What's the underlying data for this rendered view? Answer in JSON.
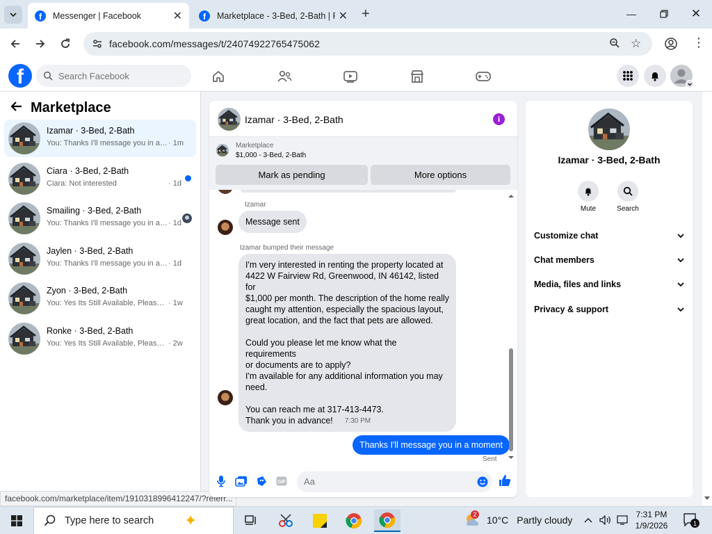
{
  "browser": {
    "tabs": [
      {
        "title": "Messenger | Facebook",
        "active": true
      },
      {
        "title": "Marketplace - 3-Bed, 2-Bath | Fa",
        "active": false
      }
    ],
    "url": "facebook.com/messages/t/24074922765475062",
    "status_url": "facebook.com/marketplace/item/1910318996412247/?referr..."
  },
  "fb_header": {
    "logo": "f",
    "search_placeholder": "Search Facebook"
  },
  "left_panel": {
    "title": "Marketplace",
    "conversations": [
      {
        "title": "Izamar · 3-Bed, 2-Bath",
        "snippet": "You: Thanks I'll message you in a mo...",
        "time": "· 1m",
        "selected": true
      },
      {
        "title": "Ciara · 3-Bed, 2-Bath",
        "snippet": "Ciara: Not interested",
        "time": "· 1d",
        "unread": true
      },
      {
        "title": "Smailing · 3-Bed, 2-Bath",
        "snippet": "You: Thanks I'll message you in a m...",
        "time": "· 1d"
      },
      {
        "title": "Jaylen · 3-Bed, 2-Bath",
        "snippet": "You: Thanks I'll message you in a mo...",
        "time": "· 1d"
      },
      {
        "title": "Zyon · 3-Bed, 2-Bath",
        "snippet": "You: Yes Its Still Available, Please Send...",
        "time": "· 1w"
      },
      {
        "title": "Ronke · 3-Bed, 2-Bath",
        "snippet": "You: Yes Its Still Available, Please Send...",
        "time": "· 2w"
      }
    ]
  },
  "chat": {
    "title": "Izamar · 3-Bed, 2-Bath",
    "marketplace_label": "Marketplace",
    "listing": "$1,000 - 3-Bed, 2-Bath",
    "mark_pending": "Mark as pending",
    "more_options": "More options",
    "sender_name": "Izamar",
    "msg1": "Message sent",
    "bumped_label": "Izamar bumped their message",
    "msg2_lines": [
      "I'm very interested in renting the property located at",
      "4422 W Fairview Rd, Greenwood, IN 46142, listed for",
      "$1,000 per month. The description of the home really",
      "caught my attention, especially the spacious layout,",
      "great location, and the fact that pets are allowed.",
      "",
      "Could you please let me know what the requirements",
      "or documents are to apply?",
      "I'm available for any additional information you may",
      "need.",
      "",
      "You can reach me at 317-413-4473.",
      "Thank you in advance!"
    ],
    "timestamp": "7:30 PM",
    "my_msg": "Thanks I'll message you in a moment",
    "sent_label": "Sent",
    "composer_placeholder": "Aa"
  },
  "right_panel": {
    "name": "Izamar · 3-Bed, 2-Bath",
    "mute": "Mute",
    "search": "Search",
    "sections": [
      "Customize chat",
      "Chat members",
      "Media, files and links",
      "Privacy & support"
    ]
  },
  "taskbar": {
    "search_placeholder": "Type here to search",
    "temperature": "10°C",
    "weather": "Partly cloudy",
    "weather_badge": "2",
    "time": "7:31 PM",
    "date": "1/9/2026",
    "notification_count": "1"
  },
  "colors": {
    "fb_blue": "#0866ff",
    "info_purple": "#9b1fd6"
  }
}
